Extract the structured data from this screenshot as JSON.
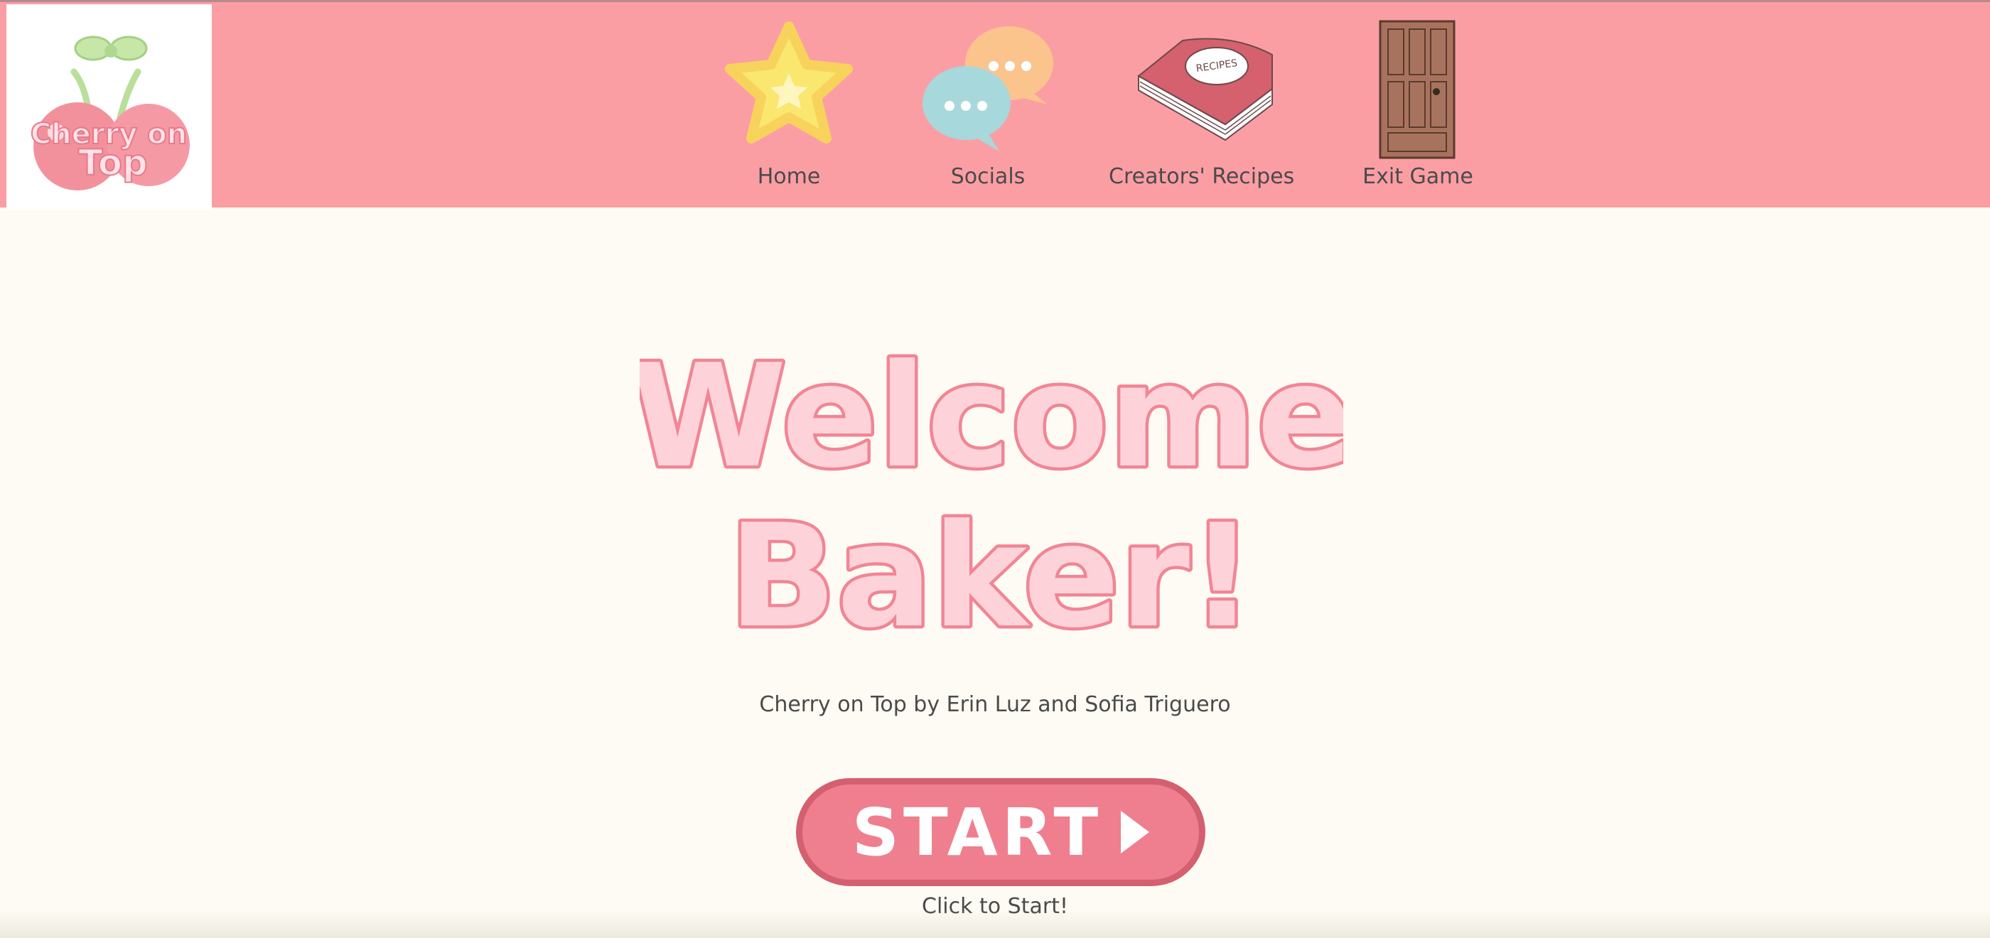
{
  "logo": {
    "text_line1": "Cherry on",
    "text_line2": "Top"
  },
  "nav": [
    {
      "label": "Home",
      "icon": "star-icon"
    },
    {
      "label": "Socials",
      "icon": "chat-bubbles-icon"
    },
    {
      "label": "Creators' Recipes",
      "icon": "recipe-book-icon",
      "icon_text": "RECIPES"
    },
    {
      "label": "Exit Game",
      "icon": "door-icon"
    }
  ],
  "title": {
    "line1": "Welcome",
    "line2": "Baker!"
  },
  "credits": "Cherry on Top by Erin Luz and Sofia Triguero",
  "start_button": {
    "label": "START"
  },
  "hint": "Click to Start!",
  "colors": {
    "header": "#fb9ea4",
    "background": "#fdfbf3",
    "button": "#ef7f8e",
    "title_fill": "#fdd3d9",
    "title_outline": "#f28595"
  }
}
